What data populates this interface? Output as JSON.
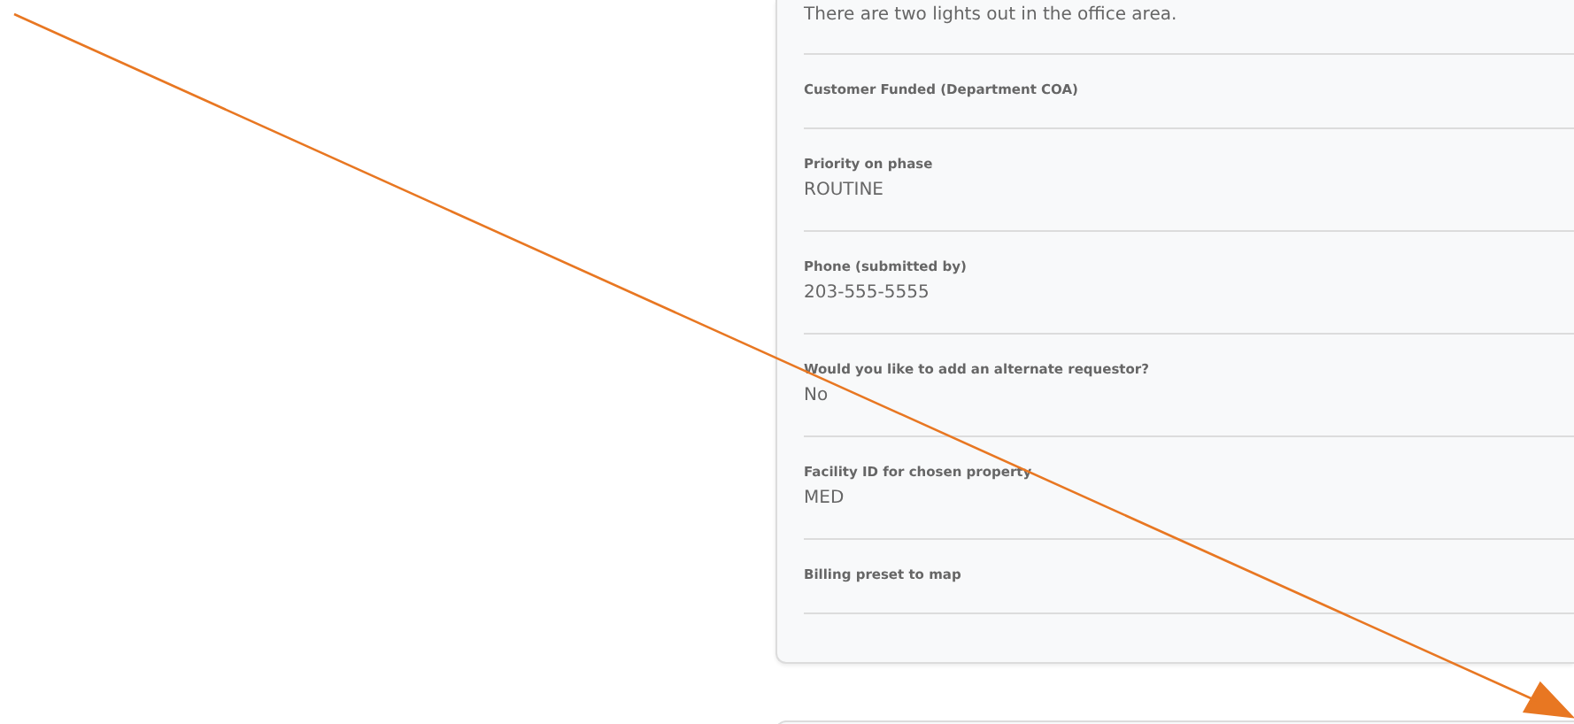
{
  "description": {
    "value": "There are two lights out in the office area."
  },
  "fields": [
    {
      "label": "Customer Funded (Department COA)"
    },
    {
      "label": "Priority on phase",
      "value": "ROUTINE"
    },
    {
      "label": "Phone (submitted by)",
      "value": "203-555-5555"
    },
    {
      "label": "Would you like to add an alternate requestor?",
      "value": "No"
    },
    {
      "label": "Facility ID for chosen property",
      "value": "MED"
    },
    {
      "label": "Billing preset to map"
    }
  ]
}
